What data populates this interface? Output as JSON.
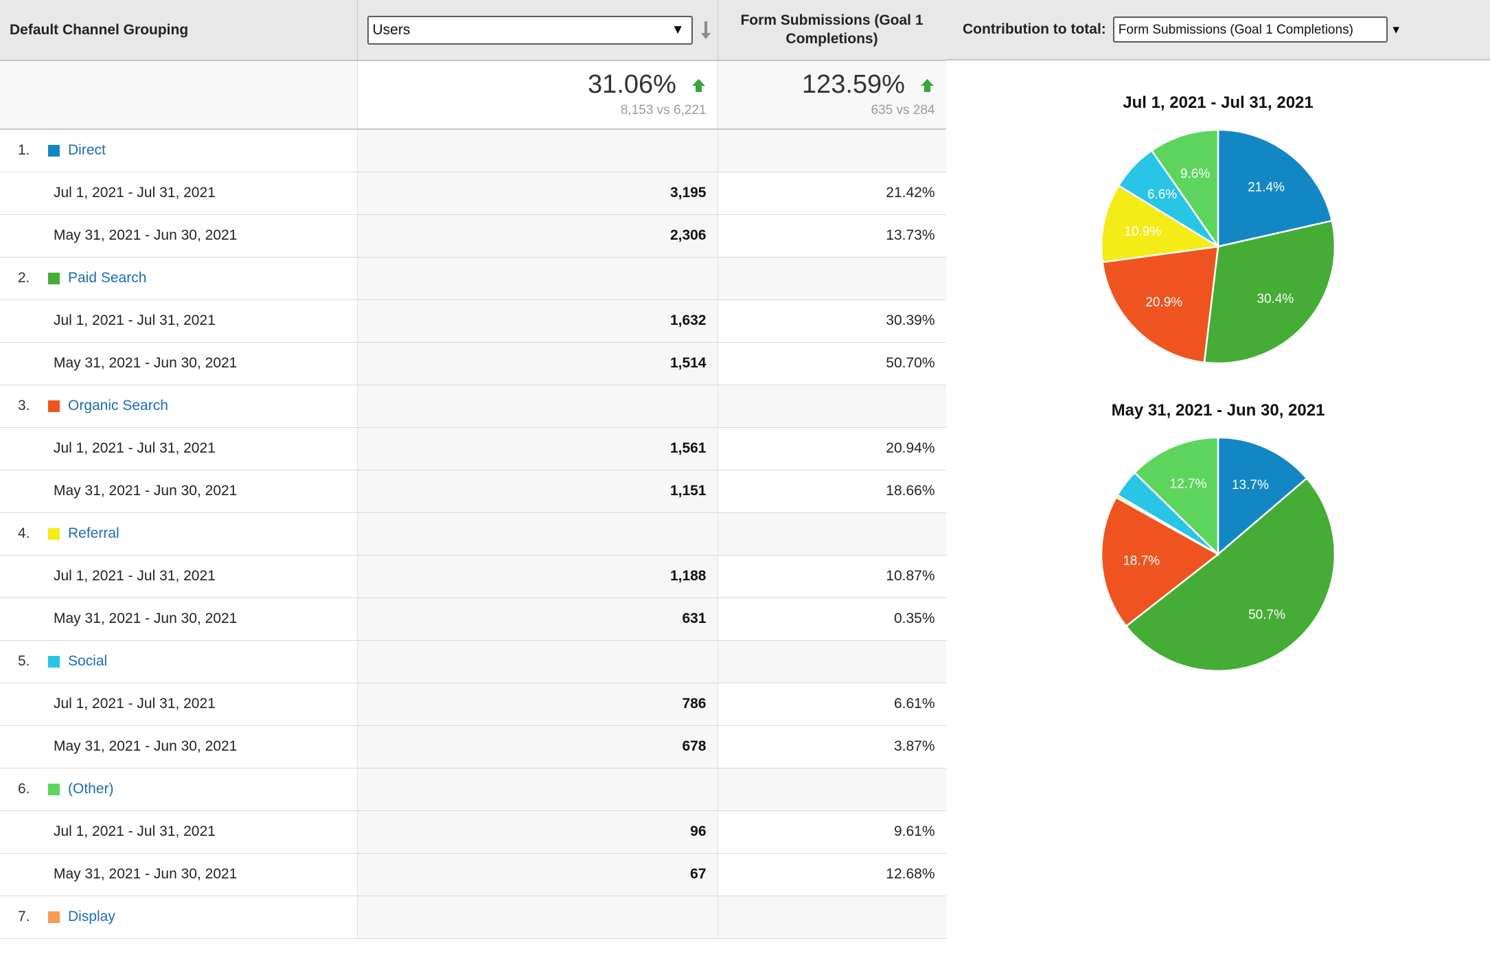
{
  "header": {
    "dimension_label": "Default Channel Grouping",
    "metric_select": {
      "value": "Users",
      "options": [
        "Users"
      ]
    },
    "sort_icon": "sort-descending-arrow-icon",
    "metric2_label": "Form Submissions (Goal 1 Completions)",
    "contribution_label": "Contribution to total:",
    "contribution_select": {
      "value": "Form Submissions (Goal 1 Completions)",
      "options": [
        "Form Submissions (Goal 1 Completions)"
      ]
    }
  },
  "totals": {
    "users": {
      "percent": "31.06%",
      "trend": "up",
      "comparison": "8,153 vs 6,221"
    },
    "goal1": {
      "percent": "123.59%",
      "trend": "up",
      "comparison": "635 vs 284"
    }
  },
  "period_labels": {
    "current": "Jul 1, 2021 - Jul 31, 2021",
    "previous": "May 31, 2021 - Jun 30, 2021"
  },
  "colors": {
    "direct": "#1387c4",
    "paid_search": "#45ad35",
    "organic_search": "#ef5420",
    "referral": "#f3ec16",
    "social": "#29c5e6",
    "other": "#5dd55d",
    "display": "#f79b52",
    "trend_up": "#3aa53a",
    "link": "#1b6db5"
  },
  "rows": [
    {
      "rank": "1.",
      "channel": "Direct",
      "color_key": "direct",
      "current": {
        "date": "Jul 1, 2021 - Jul 31, 2021",
        "users": "3,195",
        "goal1": "21.42%"
      },
      "previous": {
        "date": "May 31, 2021 - Jun 30, 2021",
        "users": "2,306",
        "goal1": "13.73%"
      }
    },
    {
      "rank": "2.",
      "channel": "Paid Search",
      "color_key": "paid_search",
      "current": {
        "date": "Jul 1, 2021 - Jul 31, 2021",
        "users": "1,632",
        "goal1": "30.39%"
      },
      "previous": {
        "date": "May 31, 2021 - Jun 30, 2021",
        "users": "1,514",
        "goal1": "50.70%"
      }
    },
    {
      "rank": "3.",
      "channel": "Organic Search",
      "color_key": "organic_search",
      "current": {
        "date": "Jul 1, 2021 - Jul 31, 2021",
        "users": "1,561",
        "goal1": "20.94%"
      },
      "previous": {
        "date": "May 31, 2021 - Jun 30, 2021",
        "users": "1,151",
        "goal1": "18.66%"
      }
    },
    {
      "rank": "4.",
      "channel": "Referral",
      "color_key": "referral",
      "current": {
        "date": "Jul 1, 2021 - Jul 31, 2021",
        "users": "1,188",
        "goal1": "10.87%"
      },
      "previous": {
        "date": "May 31, 2021 - Jun 30, 2021",
        "users": "631",
        "goal1": "0.35%"
      }
    },
    {
      "rank": "5.",
      "channel": "Social",
      "color_key": "social",
      "current": {
        "date": "Jul 1, 2021 - Jul 31, 2021",
        "users": "786",
        "goal1": "6.61%"
      },
      "previous": {
        "date": "May 31, 2021 - Jun 30, 2021",
        "users": "678",
        "goal1": "3.87%"
      }
    },
    {
      "rank": "6.",
      "channel": "(Other)",
      "color_key": "other",
      "current": {
        "date": "Jul 1, 2021 - Jul 31, 2021",
        "users": "96",
        "goal1": "9.61%"
      },
      "previous": {
        "date": "May 31, 2021 - Jun 30, 2021",
        "users": "67",
        "goal1": "12.68%"
      }
    },
    {
      "rank": "7.",
      "channel": "Display",
      "color_key": "display",
      "current": null,
      "previous": null
    }
  ],
  "chart_data": [
    {
      "type": "pie",
      "title": "Jul 1, 2021 - Jul 31, 2021",
      "labels": [
        "Direct",
        "Paid Search",
        "Organic Search",
        "Referral",
        "Social",
        "(Other)"
      ],
      "values": [
        21.42,
        30.39,
        20.94,
        10.87,
        6.61,
        9.61
      ],
      "display_labels": [
        "21.4%",
        "30.4%",
        "20.9%",
        "10.9%",
        "6.6%",
        "9.6%"
      ],
      "colors": [
        "#1387c4",
        "#45ad35",
        "#ef5420",
        "#f3ec16",
        "#29c5e6",
        "#5dd55d"
      ],
      "metric": "Form Submissions (Goal 1 Completions)",
      "legend": "none",
      "start_angle": 0
    },
    {
      "type": "pie",
      "title": "May 31, 2021 - Jun 30, 2021",
      "labels": [
        "Direct",
        "Paid Search",
        "Organic Search",
        "Referral",
        "Social",
        "(Other)"
      ],
      "values": [
        13.73,
        50.7,
        18.66,
        0.35,
        3.87,
        12.68
      ],
      "display_labels": [
        "13.7%",
        "50.7%",
        "18.7%",
        "0.4%",
        "3.9%",
        "12.7%"
      ],
      "shown_labels": [
        "13.7%",
        "50.7%",
        "18.7%",
        "",
        "",
        "12.7%"
      ],
      "colors": [
        "#1387c4",
        "#45ad35",
        "#ef5420",
        "#f3ec16",
        "#29c5e6",
        "#5dd55d"
      ],
      "metric": "Form Submissions (Goal 1 Completions)",
      "legend": "none",
      "start_angle": 0
    }
  ]
}
